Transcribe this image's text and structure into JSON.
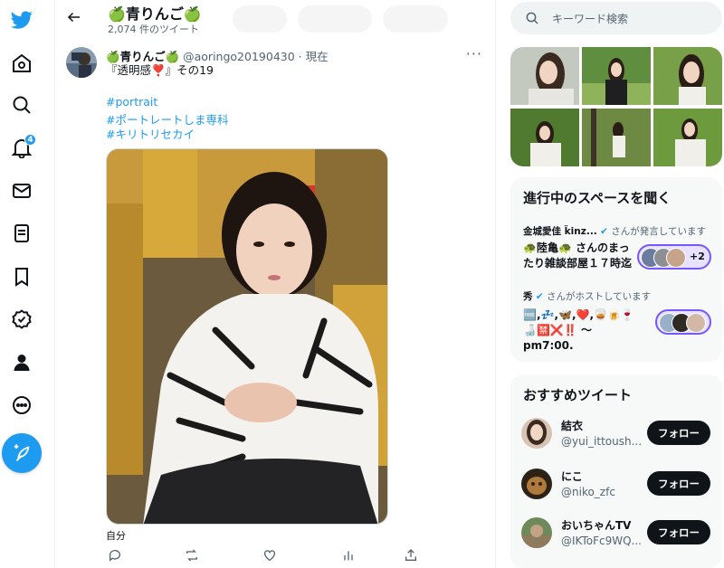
{
  "nav": {
    "items": [
      {
        "icon": "twitter-bird-icon"
      },
      {
        "icon": "home-icon"
      },
      {
        "icon": "search-icon"
      },
      {
        "icon": "bell-icon",
        "badge": "4"
      },
      {
        "icon": "mail-icon"
      },
      {
        "icon": "lists-icon"
      },
      {
        "icon": "bookmark-icon"
      },
      {
        "icon": "verified-icon"
      },
      {
        "icon": "profile-icon"
      },
      {
        "icon": "more-icon"
      }
    ],
    "compose_icon": "compose-icon"
  },
  "header": {
    "title": "🍏青りんご🍏",
    "subtitle": "2,074 件のツイート"
  },
  "tweet": {
    "name": "🍏青りんご🍏",
    "handle": "@aoringo20190430 · 現在",
    "text": "『透明感❣️』その19",
    "hashtags": [
      "#portrait",
      "#ポートレートしま専科",
      "#キリトリセカイ"
    ],
    "photo_tag": "自分",
    "more": "···"
  },
  "search": {
    "placeholder": "キーワード検索"
  },
  "spaces": {
    "title": "進行中のスペースを聞く",
    "items": [
      {
        "host_name": "金城愛佳 k̈inz...",
        "host_role": "さんが発言しています",
        "title_lines": [
          "🐢陸亀🐢 さんのまっ",
          "たり雑談部屋１７時迄"
        ],
        "plus": "+2"
      },
      {
        "host_name": "秀",
        "host_role": "さんがホストしています",
        "title_lines": [
          "🆓,💤,🦋,❤️,🥃🍺🍷",
          "🍶🈲❌‼️ 〜",
          "pm7:00."
        ]
      }
    ]
  },
  "recommend": {
    "title": "おすすめツイート",
    "follow_label": "フォロー",
    "users": [
      {
        "name": "結衣",
        "handle": "@yui_ittoush..."
      },
      {
        "name": "にこ",
        "handle": "@niko_zfc"
      },
      {
        "name": "おいちゃんTV",
        "handle": "@IKToFc9WQ..."
      }
    ]
  },
  "colors": {
    "accent": "#1d9bf0",
    "spaces": "#7856ff",
    "text": "#0f1419",
    "muted": "#536471"
  }
}
